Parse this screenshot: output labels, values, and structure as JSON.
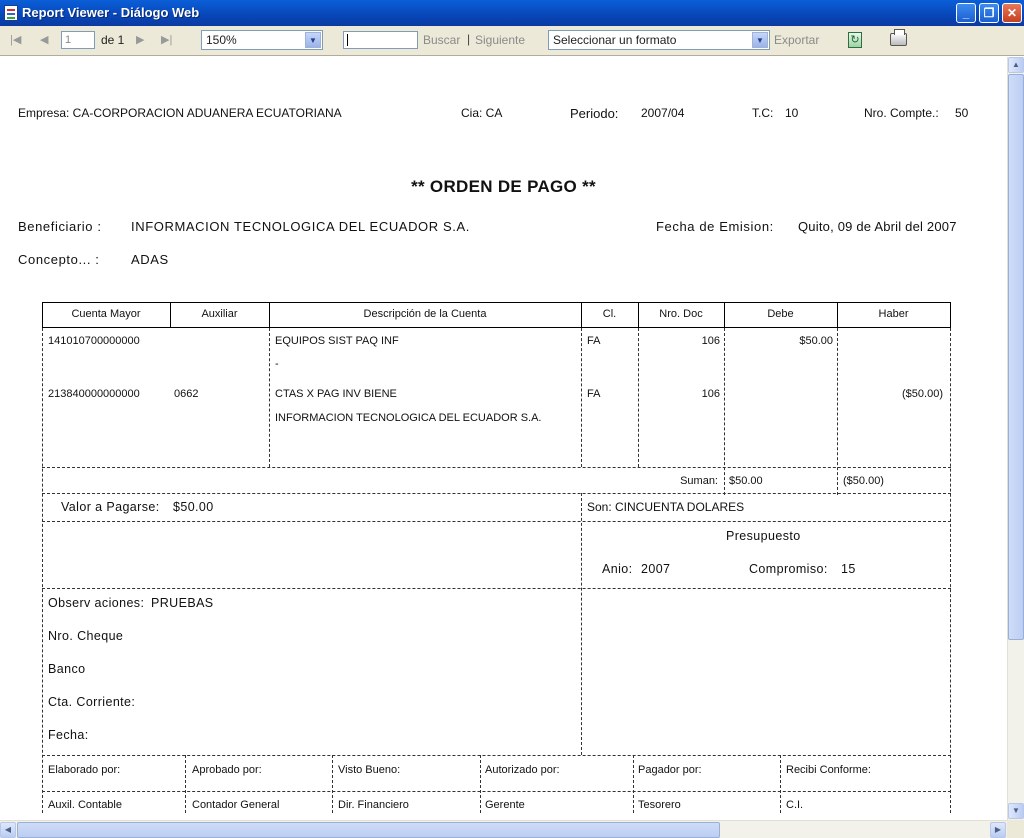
{
  "window": {
    "title": "Report Viewer - Diálogo Web",
    "minimize": "_",
    "maximize": "❐",
    "close": "✕"
  },
  "toolbar": {
    "first_icon": "first-page-icon",
    "prev_icon": "prev-page-icon",
    "next_icon": "next-page-icon",
    "last_icon": "last-page-icon",
    "page_value": "1",
    "page_of": "de 1",
    "zoom": "150%",
    "search_value": "",
    "buscar": "Buscar",
    "sep": "|",
    "siguiente": "Siguiente",
    "format": "Seleccionar un formato",
    "exportar": "Exportar"
  },
  "report": {
    "header": {
      "empresa": "Empresa: CA-CORPORACION ADUANERA ECUATORIANA",
      "cia": "Cia: CA",
      "periodo_label": "Periodo:",
      "periodo": "2007/04",
      "tc_label": "T.C:",
      "tc": "10",
      "nro_label": "Nro. Compte.:",
      "nro": "50"
    },
    "title": "** ORDEN DE PAGO **",
    "beneficiario_label": "Beneficiario :",
    "beneficiario": "INFORMACION TECNOLOGICA DEL ECUADOR S.A.",
    "fecha_label": "Fecha de Emision:",
    "fecha": "Quito, 09 de Abril del 2007",
    "concepto_label": "Concepto... :",
    "concepto": "ADAS",
    "table": {
      "columns": [
        "Cuenta Mayor",
        "Auxiliar",
        "Descripción de la Cuenta",
        "Cl.",
        "Nro. Doc",
        "Debe",
        "Haber"
      ],
      "rows": [
        {
          "cuenta": "141010700000000",
          "auxiliar": "",
          "descripcion": "EQUIPOS SIST PAQ INF",
          "desc2": "-",
          "cl": "FA",
          "doc": "106",
          "debe": "$50.00",
          "haber": ""
        },
        {
          "cuenta": "213840000000000",
          "auxiliar": "0662",
          "descripcion": "CTAS X PAG INV BIENE",
          "desc2": "INFORMACION TECNOLOGICA DEL ECUADOR S.A.",
          "cl": "FA",
          "doc": "106",
          "debe": "",
          "haber": "($50.00)"
        }
      ],
      "suman_label": "Suman:",
      "suman_debe": "$50.00",
      "suman_haber": "($50.00)"
    },
    "valor_label": "Valor a Pagarse:",
    "valor": "$50.00",
    "son": "Son: CINCUENTA DOLARES",
    "presupuesto": "Presupuesto",
    "anio_label": "Anio:",
    "anio": "2007",
    "compromiso_label": "Compromiso:",
    "compromiso": "15",
    "observaciones_label": "Observ aciones:",
    "observaciones": "PRUEBAS",
    "cheque_label": "Nro. Cheque",
    "banco_label": "Banco",
    "cta_label": "Cta. Corriente:",
    "fecha2_label": "Fecha:",
    "firmas": [
      {
        "role": "Elaborado por:",
        "title": "Auxil. Contable"
      },
      {
        "role": "Aprobado por:",
        "title": "Contador General"
      },
      {
        "role": "Visto Bueno:",
        "title": "Dir. Financiero"
      },
      {
        "role": "Autorizado por:",
        "title": "Gerente"
      },
      {
        "role": "Pagador por:",
        "title": "Tesorero"
      },
      {
        "role": "Recibi Conforme:",
        "title": "C.I."
      }
    ]
  }
}
